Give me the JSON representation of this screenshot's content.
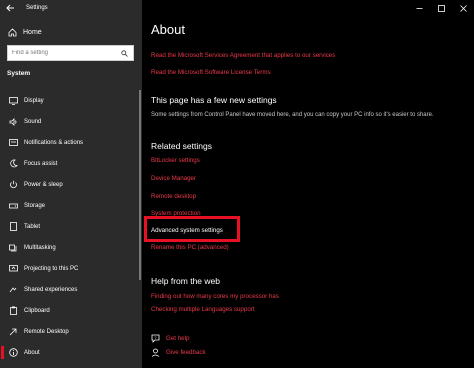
{
  "app": {
    "title": "Settings"
  },
  "sidebar": {
    "home_label": "Home",
    "search_placeholder": "Find a setting",
    "section_label": "System",
    "items": [
      {
        "label": "Display",
        "icon": "display-icon"
      },
      {
        "label": "Sound",
        "icon": "sound-icon"
      },
      {
        "label": "Notifications & actions",
        "icon": "notifications-icon"
      },
      {
        "label": "Focus assist",
        "icon": "focus-assist-icon"
      },
      {
        "label": "Power & sleep",
        "icon": "power-icon"
      },
      {
        "label": "Storage",
        "icon": "storage-icon"
      },
      {
        "label": "Tablet",
        "icon": "tablet-icon"
      },
      {
        "label": "Multitasking",
        "icon": "multitasking-icon"
      },
      {
        "label": "Projecting to this PC",
        "icon": "projecting-icon"
      },
      {
        "label": "Shared experiences",
        "icon": "shared-experiences-icon"
      },
      {
        "label": "Clipboard",
        "icon": "clipboard-icon"
      },
      {
        "label": "Remote Desktop",
        "icon": "remote-desktop-icon"
      },
      {
        "label": "About",
        "icon": "info-icon",
        "active": true
      }
    ]
  },
  "main": {
    "title": "About",
    "license_links": [
      "Read the Microsoft Services Agreement that applies to our services",
      "Read the Microsoft Software License Terms"
    ],
    "new_settings": {
      "heading": "This page has a few new settings",
      "description": "Some settings from Control Panel have moved here, and you can copy your PC info so it's easier to share."
    },
    "related": {
      "heading": "Related settings",
      "links": [
        "BitLocker settings",
        "Device Manager",
        "Remote desktop",
        "System protection",
        "Advanced system settings",
        "Rename this PC (advanced)"
      ]
    },
    "help": {
      "heading": "Help from the web",
      "links": [
        "Finding out how many cores my processor has",
        "Checking multiple Languages support"
      ]
    },
    "footer": {
      "get_help": "Get help",
      "give_feedback": "Give feedback"
    }
  },
  "colors": {
    "accent": "#e8394a",
    "highlight_box": "#e81123",
    "sidebar_bg": "#2b2b2b",
    "main_bg": "#000000"
  }
}
